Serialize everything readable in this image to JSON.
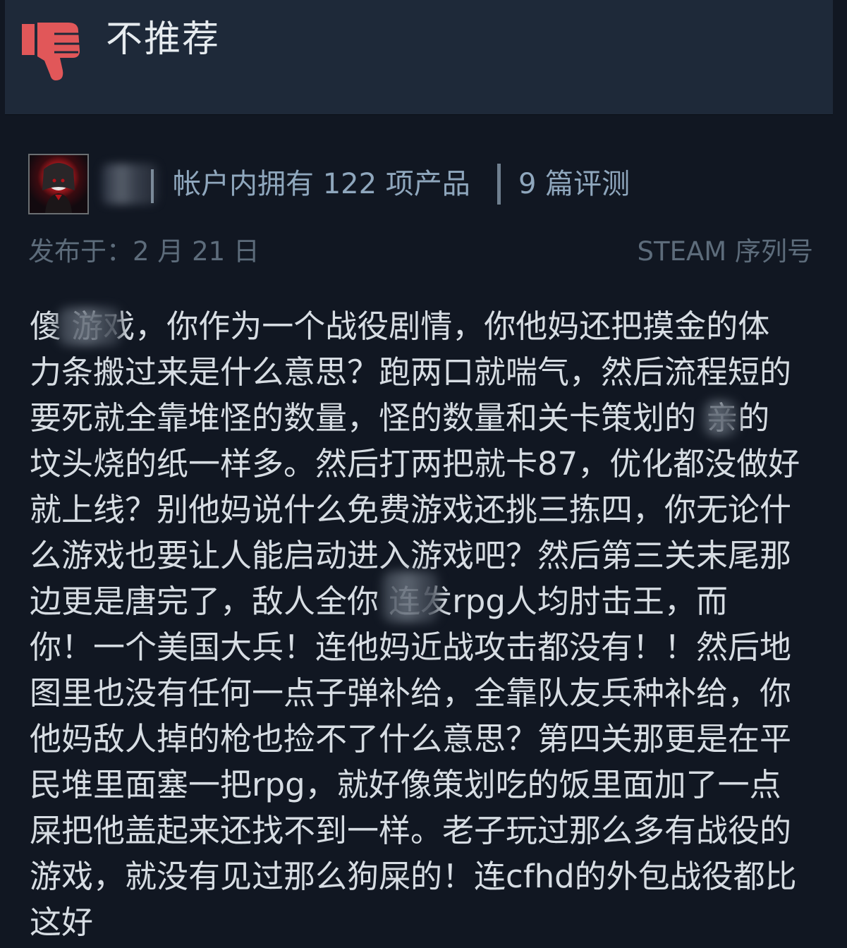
{
  "header": {
    "verdict": "不推荐",
    "thumb_icon": "thumbs-down-icon",
    "thumb_color": "#e15759"
  },
  "author": {
    "avatar_icon": "user-avatar",
    "products": "帐户内拥有 122 项产品",
    "reviews": "9 篇评测"
  },
  "meta": {
    "posted": "发布于：2 月 21 日",
    "product_key": "STEAM 序列号"
  },
  "review": {
    "lines": [
      "傻  游戏，你作为一个战役剧情，你他妈还把摸金的体",
      "力条搬过来是什么意思？跑两口就喘气，然后流程短的",
      "要死就全靠堆怪的数量，怪的数量和关卡策划的  亲的",
      "坟头烧的纸一样多。然后打两把就卡87，优化都没做好",
      "就上线？别他妈说什么免费游戏还挑三拣四，你无论什",
      "么游戏也要让人能启动进入游戏吧？然后第三关末尾那",
      "边更是唐完了，敌人全你  连发rpg人均肘击王，而",
      "你！一个美国大兵！连他妈近战攻击都没有！！然后地",
      "图里也没有任何一点子弹补给，全靠队友兵种补给，你",
      "他妈敌人掉的枪也捡不了什么意思？第四关那更是在平",
      "民堆里面塞一把rpg，就好像策划吃的饭里面加了一点",
      "屎把他盖起来还找不到一样。老子玩过那么多有战役的",
      "游戏，就没有见过那么狗屎的！连cfhd的外包战役都比",
      "这好"
    ]
  }
}
